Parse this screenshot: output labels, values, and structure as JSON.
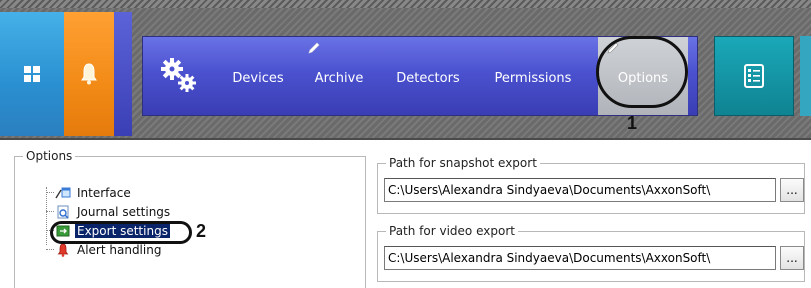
{
  "toolbar": {
    "menu_items": [
      "Devices",
      "Archive",
      "Detectors",
      "Permissions",
      "Options"
    ],
    "icons": {
      "windows_tile": "windows-logo-icon",
      "alert_tile": "bell-icon",
      "settings": "gears-icon",
      "edit_marker": "pencil-icon",
      "right_tile": "checklist-icon"
    },
    "colors": {
      "windows_tile": "#2a8fd0",
      "alert_tile": "#f28a16",
      "menu_bar": "#4b52cf",
      "options_active": "#b8bcc2",
      "right_tile": "#128f9e"
    }
  },
  "annotations": {
    "callout_1": "1",
    "callout_2": "2"
  },
  "options_panel": {
    "title": "Options",
    "tree": [
      {
        "label": "Interface",
        "icon": "interface-icon"
      },
      {
        "label": "Journal settings",
        "icon": "journal-icon"
      },
      {
        "label": "Export settings",
        "icon": "export-icon",
        "selected": true
      },
      {
        "label": "Alert handling",
        "icon": "alert-icon"
      }
    ]
  },
  "snapshot_export": {
    "title": "Path for snapshot export",
    "path": "C:\\Users\\Alexandra Sindyaeva\\Documents\\AxxonSoft\\",
    "browse_label": "..."
  },
  "video_export": {
    "title": "Path for video export",
    "path": "C:\\Users\\Alexandra Sindyaeva\\Documents\\AxxonSoft\\",
    "browse_label": "..."
  }
}
